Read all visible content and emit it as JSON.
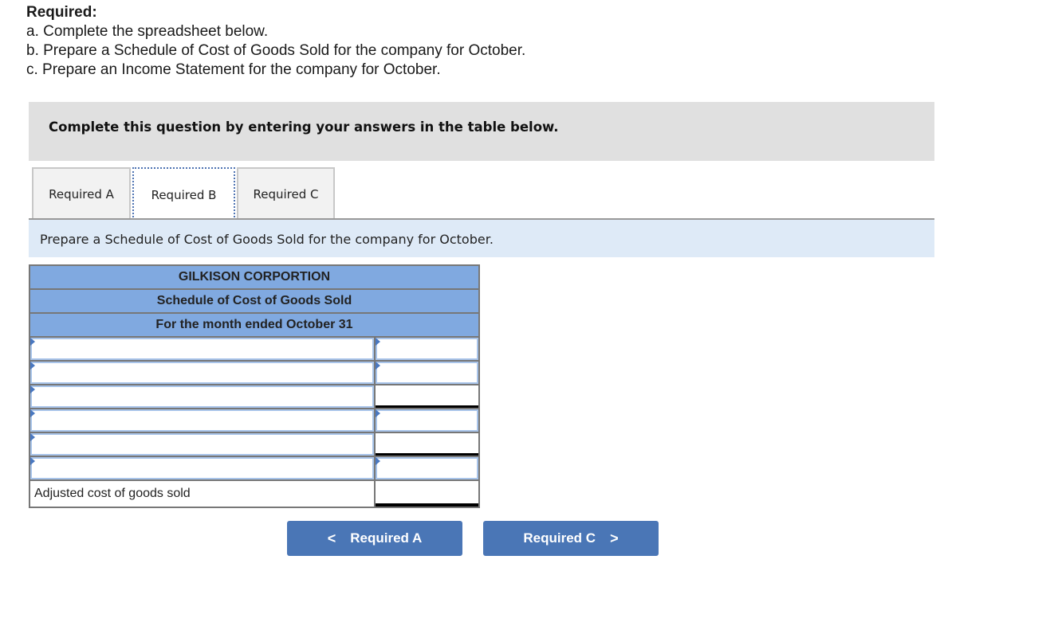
{
  "required": {
    "title": "Required:",
    "items": [
      "a. Complete the spreadsheet below.",
      "b. Prepare a Schedule of Cost of Goods Sold for the company for October.",
      "c. Prepare an Income Statement for the company for October."
    ]
  },
  "instruction": "Complete this question by entering your answers in the table below.",
  "tabs": [
    {
      "label": "Required A",
      "active": false
    },
    {
      "label": "Required B",
      "active": true
    },
    {
      "label": "Required C",
      "active": false
    }
  ],
  "prompt": "Prepare a Schedule of Cost of Goods Sold for the company for October.",
  "sheet": {
    "company": "GILKISON CORPORTION",
    "statement": "Schedule of Cost of Goods Sold",
    "period": "For the month ended October 31",
    "rows": [
      {
        "label": "",
        "amount": ""
      },
      {
        "label": "",
        "amount": ""
      },
      {
        "label": "",
        "amount": ""
      },
      {
        "label": "",
        "amount": ""
      },
      {
        "label": "",
        "amount": ""
      },
      {
        "label": "",
        "amount": ""
      }
    ],
    "total_label": "Adjusted cost of goods sold",
    "total_amount": ""
  },
  "nav": {
    "prev_label": "Required A",
    "next_label": "Required C",
    "prev_icon": "chevron-left-icon",
    "next_icon": "chevron-right-icon"
  },
  "colors": {
    "header_blue": "#80a9e0",
    "button_blue": "#4a76b6",
    "prompt_bg": "#deeaf7",
    "instruction_bg": "#e0e0e0"
  }
}
